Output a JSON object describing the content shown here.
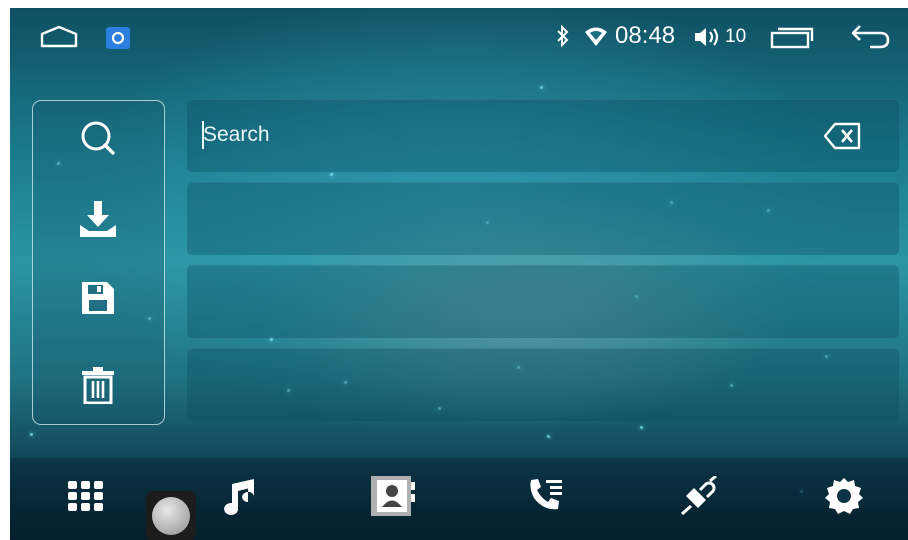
{
  "status_bar": {
    "time": "08:48",
    "volume": "10",
    "icons": [
      "home-icon",
      "app-notification-icon",
      "bluetooth-icon",
      "wifi-icon",
      "speaker-icon",
      "recent-apps-icon",
      "back-icon"
    ]
  },
  "sidebar": {
    "buttons": [
      "search-icon",
      "download-icon",
      "save-icon",
      "delete-icon"
    ]
  },
  "search": {
    "placeholder": "Search",
    "value": ""
  },
  "list_rows": [
    "",
    "",
    ""
  ],
  "bottom_nav": {
    "items": [
      "dialpad-icon",
      "music-icon",
      "contacts-icon",
      "call-log-icon",
      "link-icon",
      "settings-icon"
    ]
  },
  "colors": {
    "accent": "#2b95a3",
    "foreground": "#ffffff"
  }
}
